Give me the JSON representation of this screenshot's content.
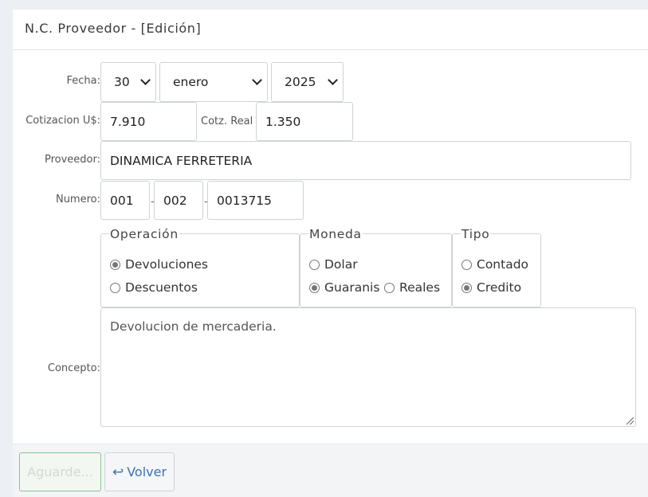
{
  "header": {
    "title": "N.C. Proveedor - [Edición]"
  },
  "form": {
    "fecha_label": "Fecha:",
    "day": "30",
    "month": "enero",
    "year": "2025",
    "cotizacion_label": "Cotizacion U$:",
    "cotizacion_value": "7.910",
    "cotz_real_label": "Cotz. Real",
    "cotz_real_value": "1.350",
    "proveedor_label": "Proveedor:",
    "proveedor_value": "DINAMICA FERRETERIA",
    "numero_label": "Numero:",
    "numero_1": "001",
    "numero_2": "002",
    "numero_3": "0013715",
    "numero_sep": "-",
    "concepto_label": "Concepto:",
    "concepto_value": "Devolucion de mercaderia."
  },
  "operacion": {
    "legend": "Operación",
    "options": [
      {
        "label": "Devoluciones",
        "checked": true
      },
      {
        "label": "Descuentos",
        "checked": false
      }
    ]
  },
  "moneda": {
    "legend": "Moneda",
    "options": [
      {
        "label": "Dolar",
        "checked": false
      },
      {
        "label": "Guaranis",
        "checked": true
      },
      {
        "label": "Reales",
        "checked": false
      }
    ]
  },
  "tipo": {
    "legend": "Tipo",
    "options": [
      {
        "label": "Contado",
        "checked": false
      },
      {
        "label": "Credito",
        "checked": true
      }
    ]
  },
  "footer": {
    "save_label": "Aguarde...",
    "back_label": "Volver",
    "back_icon": "return-arrow-icon"
  }
}
